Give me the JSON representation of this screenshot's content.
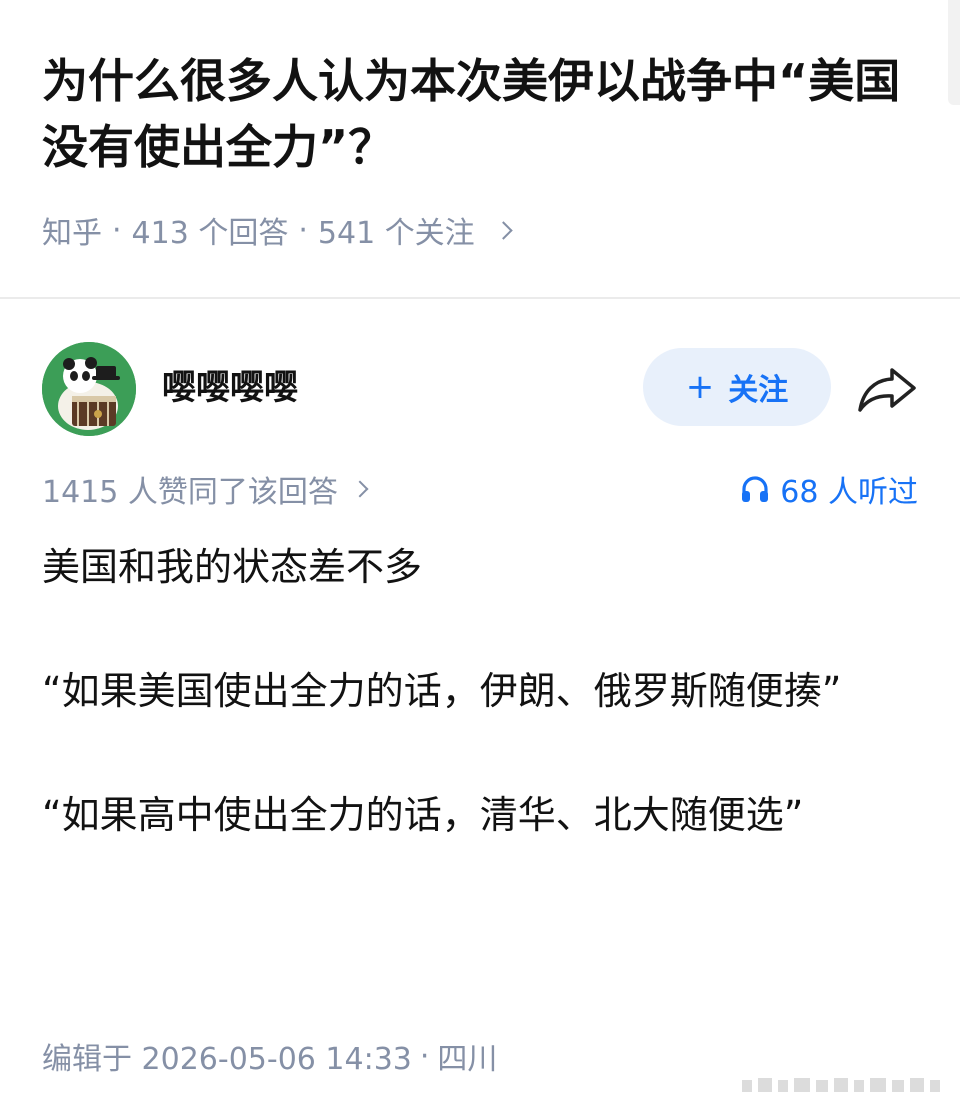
{
  "question": {
    "title": "为什么很多人认为本次美伊以战争中“美国没有使出全力”？",
    "source": "知乎",
    "separator": "·",
    "answers_count": "413 个回答",
    "followers_count": "541 个关注"
  },
  "answer": {
    "author": {
      "name": "嘤嘤嘤嘤",
      "avatar_icon": "panda-avatar"
    },
    "follow_button": {
      "label": "关注",
      "icon": "plus-icon"
    },
    "share_icon": "share-arrow-icon",
    "upvote_summary": "1415 人赞同了该回答",
    "listen_summary": "68 人听过",
    "paragraphs": [
      "美国和我的状态差不多",
      "“如果美国使出全力的话，伊朗、俄罗斯随便揍”",
      "“如果高中使出全力的话，清华、北大随便选”"
    ],
    "edit_time": "编辑于 2026-05-06 14:33",
    "edit_location": "四川",
    "separator": "·"
  },
  "colors": {
    "accent_blue": "#1772f6",
    "follow_bg": "#e8f0fb",
    "meta_gray": "#8590a6",
    "text": "#121212",
    "avatar_green": "#3c9e57"
  }
}
